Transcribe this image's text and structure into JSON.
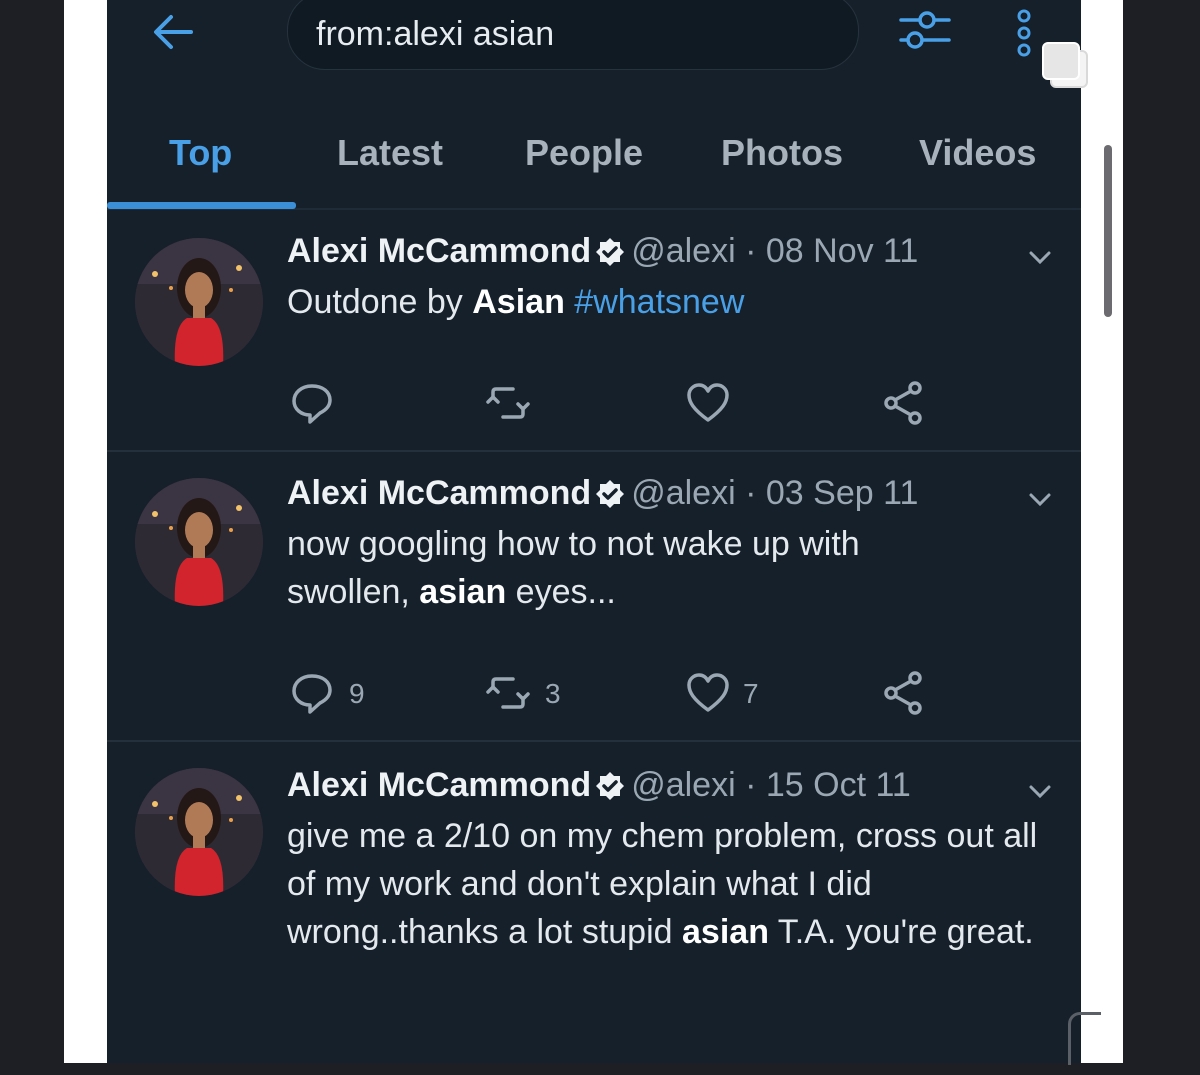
{
  "search": {
    "query": "from:alexi asian"
  },
  "tabs": [
    {
      "label": "Top",
      "active": true
    },
    {
      "label": "Latest",
      "active": false
    },
    {
      "label": "People",
      "active": false
    },
    {
      "label": "Photos",
      "active": false
    },
    {
      "label": "Videos",
      "active": false
    }
  ],
  "tweets": [
    {
      "name": "Alexi McCammond",
      "handle": "@alexi",
      "separator": "·",
      "date": "08 Nov 11",
      "text_parts": [
        "Outdone by ",
        "Asian",
        " ",
        "#whatsnew"
      ],
      "replies": "",
      "retweets": "",
      "likes": ""
    },
    {
      "name": "Alexi McCammond",
      "handle": "@alexi",
      "separator": "·",
      "date": "03 Sep 11",
      "text_parts": [
        "now googling how to not wake up with swollen, ",
        "asian",
        " eyes..."
      ],
      "replies": "9",
      "retweets": "3",
      "likes": "7"
    },
    {
      "name": "Alexi McCammond",
      "handle": "@alexi",
      "separator": "·",
      "date": "15 Oct 11",
      "text_parts": [
        "give me a 2/10 on my chem problem, cross out all of my work and don't explain what I did wrong..thanks a lot stupid ",
        "asian",
        " T.A. you're great."
      ],
      "replies": "",
      "retweets": "",
      "likes": ""
    }
  ],
  "colors": {
    "background": "#15202b",
    "accent": "#4aa0e6",
    "text": "#e4e9ed",
    "muted": "#9ba8b4"
  },
  "icons": [
    "back-arrow-icon",
    "filter-icon",
    "more-vertical-icon",
    "verified-icon",
    "chevron-down-icon",
    "reply-icon",
    "retweet-icon",
    "like-icon",
    "share-icon",
    "copy-icon"
  ]
}
